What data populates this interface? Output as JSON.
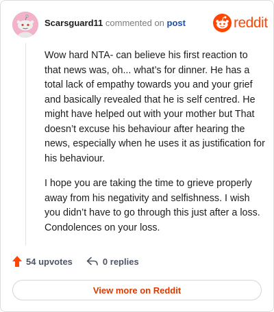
{
  "comment": {
    "username": "Scarsguard11",
    "action_text": "commented on",
    "post_link": "post",
    "paragraphs": [
      "Wow hard NTA- can believe his first reaction to that news was, oh... what’s for dinner. He has a total lack of empathy towards you and your grief and basically revealed that he is self centred. He might have helped out with your mother but That doesn’t excuse his behaviour after hearing the news, especially when he uses it as justification for his behaviour.",
      "I hope you are taking the time to grieve properly away from his negativity and selfishness. I wish you didn’t have to go through this just after a loss. Condolences on your loss."
    ]
  },
  "brand": {
    "wordmark": "reddit",
    "color": "#ff4500"
  },
  "footer": {
    "upvotes": "54 upvotes",
    "replies": "0 replies",
    "view_button": "View more on Reddit"
  }
}
